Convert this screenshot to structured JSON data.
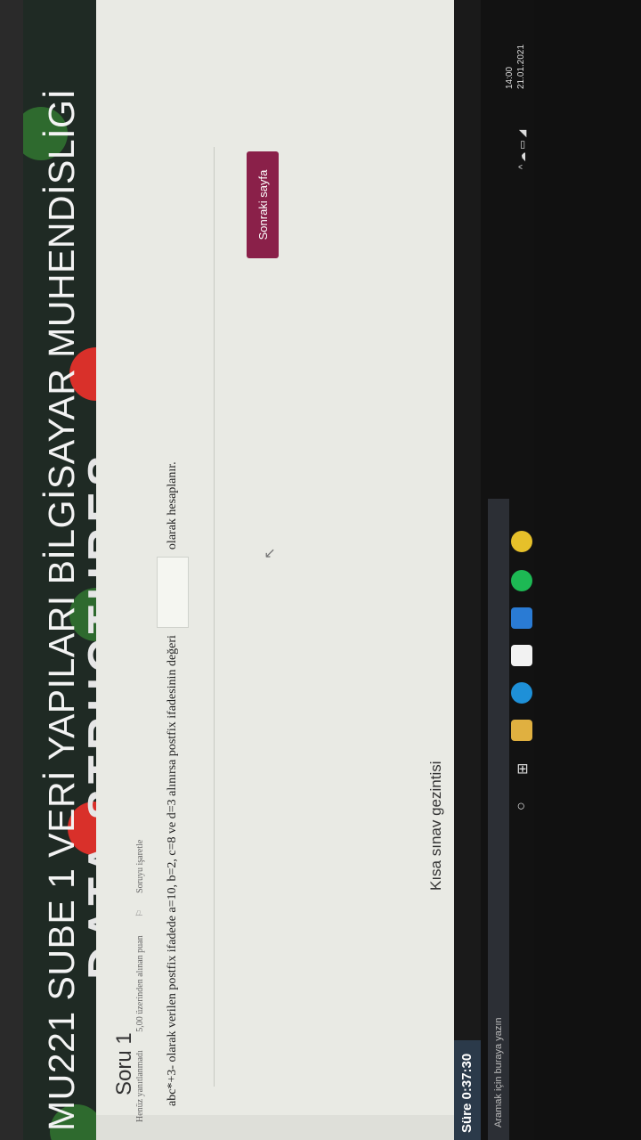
{
  "banner": {
    "title": "MU221 SUBE 1 VERİ YAPILARI BİLGİSAYAR MUHENDİSLİGİ",
    "subtitle": "DATA STRUCTURES"
  },
  "question": {
    "title": "Soru 1",
    "status": "Henüz yanıtlanmadı",
    "points": "5,00 üzerinden alınan puan",
    "flag_label": "Soruyu işaretle",
    "text_before": "abc*+3- olarak verilen postfix ifadede a=10, b=2, c=8 ve d=3 alınırsa postfix ifadesinin değeri",
    "text_after": "olarak hesaplanır.",
    "answer_value": ""
  },
  "next_button": "Sonraki sayfa",
  "quiz_nav": {
    "title": "Kısa sınav gezintisi"
  },
  "timer": {
    "label": "Süre 0:37:30"
  },
  "taskbar": {
    "search_placeholder": "Aramak için buraya yazın",
    "icons": [
      "search-icon",
      "task-view-icon",
      "file-explorer-icon",
      "edge-icon",
      "store-icon",
      "mail-icon",
      "spotify-icon",
      "chrome-icon"
    ],
    "clock_time": "14:00",
    "clock_date": "21.01.2021"
  },
  "colors": {
    "accent": "#8a2049",
    "banner_bg": "#1f2a24",
    "page_bg": "#e9eae4",
    "timer_bg": "#2b3a4a"
  }
}
